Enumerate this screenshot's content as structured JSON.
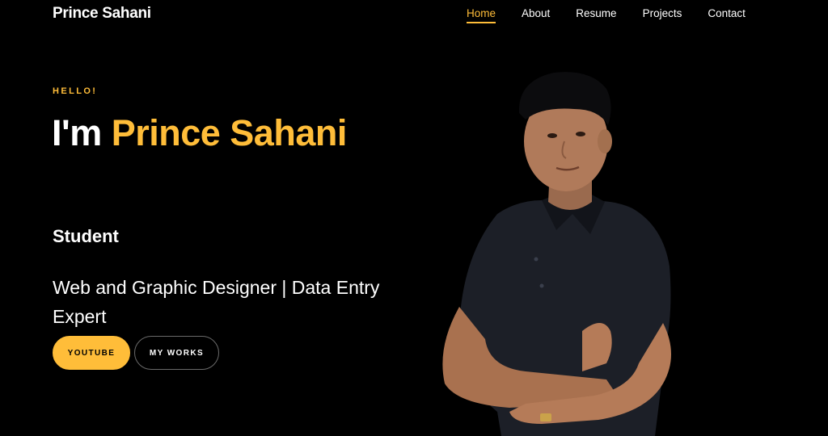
{
  "brand": {
    "name": "Prince Sahani"
  },
  "nav": {
    "items": [
      {
        "label": "Home",
        "active": true
      },
      {
        "label": "About",
        "active": false
      },
      {
        "label": "Resume",
        "active": false
      },
      {
        "label": "Projects",
        "active": false
      },
      {
        "label": "Contact",
        "active": false
      }
    ]
  },
  "hero": {
    "eyebrow": "HELLO!",
    "title_prefix": "I'm ",
    "title_name": "Prince Sahani",
    "role": "Student",
    "description": "Web and Graphic Designer | Data Entry Expert",
    "buttons": {
      "primary_label": "YOUTUBE",
      "secondary_label": "MY WORKS"
    }
  },
  "theme": {
    "accent": "#ffbd39",
    "background": "#000000",
    "text": "#ffffff"
  },
  "portrait": {
    "icon": "person-photo"
  }
}
